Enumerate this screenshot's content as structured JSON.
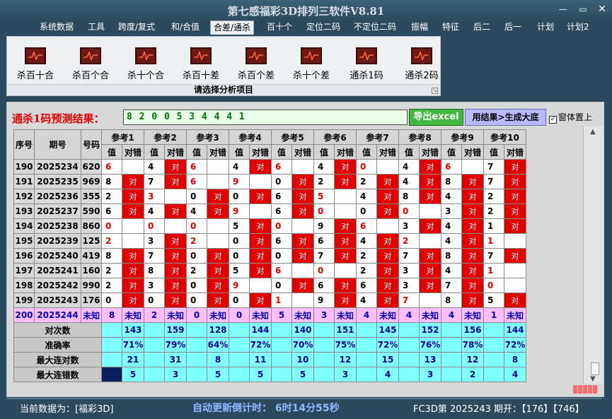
{
  "window": {
    "title": "第七感福彩3D排列三软件V8.81"
  },
  "menu": [
    "系统数据",
    "工具",
    "跨度/复式",
    "和/合值",
    "合差/通杀",
    "百十个",
    "定位二码",
    "不定位二码",
    "振幅",
    "特征",
    "后二",
    "后一",
    "计划",
    "计划2"
  ],
  "menu_active_index": 4,
  "ribbon": {
    "buttons": [
      "杀百十合",
      "杀百个合",
      "杀十个合",
      "杀百十差",
      "杀百个差",
      "杀十个差",
      "通杀1码",
      "通杀2码"
    ],
    "caption": "请选择分析项目"
  },
  "prediction": {
    "label": "通杀1码预测结果：",
    "value": "8 2 0 0 5 3 4 4 4 1",
    "export_label": "导出excel",
    "generate_label": "用结果>生成大底",
    "ontop_label": "窗体置上",
    "ontop_checked": true,
    "ontop_mark": "✓"
  },
  "table": {
    "headers": {
      "seq": "序号",
      "period": "期号",
      "number": "号码",
      "value": "值",
      "hit": "对错"
    },
    "refs": [
      "参考1",
      "参考2",
      "参考3",
      "参考4",
      "参考5",
      "参考6",
      "参考7",
      "参考8",
      "参考9",
      "参考10"
    ],
    "hit_text": "对",
    "rows": [
      {
        "seq": "190",
        "period": "2025234",
        "num": "620",
        "vals": [
          "6",
          "4",
          "6",
          "4",
          "6",
          "4",
          "0",
          "4",
          "6",
          "7"
        ],
        "hits": [
          0,
          1,
          0,
          1,
          0,
          1,
          0,
          1,
          0,
          1
        ]
      },
      {
        "seq": "191",
        "period": "2025235",
        "num": "969",
        "vals": [
          "8",
          "7",
          "6",
          "9",
          "0",
          "2",
          "2",
          "4",
          "8",
          "7"
        ],
        "hits": [
          1,
          1,
          0,
          0,
          1,
          1,
          1,
          1,
          1,
          1
        ]
      },
      {
        "seq": "192",
        "period": "2025236",
        "num": "355",
        "vals": [
          "2",
          "3",
          "0",
          "0",
          "6",
          "5",
          "4",
          "8",
          "4",
          "2"
        ],
        "hits": [
          1,
          0,
          1,
          1,
          1,
          0,
          1,
          1,
          1,
          1
        ]
      },
      {
        "seq": "193",
        "period": "2025237",
        "num": "590",
        "vals": [
          "6",
          "4",
          "4",
          "9",
          "6",
          "0",
          "0",
          "0",
          "3",
          "2"
        ],
        "hits": [
          1,
          1,
          1,
          0,
          1,
          0,
          1,
          0,
          1,
          1
        ]
      },
      {
        "seq": "194",
        "period": "2025238",
        "num": "860",
        "vals": [
          "0",
          "0",
          "0",
          "5",
          "0",
          "9",
          "6",
          "3",
          "4",
          "1"
        ],
        "hits": [
          0,
          0,
          0,
          1,
          0,
          1,
          0,
          1,
          1,
          1
        ]
      },
      {
        "seq": "195",
        "period": "2025239",
        "num": "125",
        "vals": [
          "2",
          "3",
          "2",
          "0",
          "6",
          "6",
          "4",
          "2",
          "4",
          "1"
        ],
        "hits": [
          0,
          1,
          0,
          1,
          1,
          1,
          1,
          0,
          1,
          0
        ]
      },
      {
        "seq": "196",
        "period": "2025240",
        "num": "419",
        "vals": [
          "8",
          "7",
          "0",
          "0",
          "0",
          "7",
          "2",
          "7",
          "8",
          "7"
        ],
        "hits": [
          1,
          1,
          1,
          1,
          1,
          1,
          1,
          1,
          1,
          1
        ]
      },
      {
        "seq": "197",
        "period": "2025241",
        "num": "160",
        "vals": [
          "2",
          "8",
          "2",
          "5",
          "6",
          "0",
          "2",
          "3",
          "4",
          "1"
        ],
        "hits": [
          1,
          1,
          1,
          1,
          0,
          0,
          1,
          1,
          1,
          0
        ]
      },
      {
        "seq": "198",
        "period": "2025242",
        "num": "990",
        "vals": [
          "2",
          "3",
          "0",
          "9",
          "0",
          "6",
          "6",
          "3",
          "7",
          "0"
        ],
        "hits": [
          1,
          1,
          1,
          0,
          1,
          1,
          1,
          1,
          1,
          0
        ]
      },
      {
        "seq": "199",
        "period": "2025243",
        "num": "176",
        "vals": [
          "0",
          "0",
          "0",
          "0",
          "1",
          "9",
          "4",
          "7",
          "8",
          "5"
        ],
        "hits": [
          1,
          1,
          1,
          1,
          0,
          1,
          1,
          0,
          1,
          1
        ]
      }
    ],
    "unknown_row": {
      "seq": "200",
      "period": "2025244",
      "num": "未知",
      "vals": [
        "8",
        "2",
        "0",
        "0",
        "5",
        "3",
        "4",
        "4",
        "4",
        "1"
      ],
      "hit_text": "未知"
    },
    "stats": [
      {
        "label": "对次数",
        "values": [
          "143",
          "159",
          "128",
          "144",
          "140",
          "151",
          "145",
          "152",
          "156",
          "144"
        ]
      },
      {
        "label": "准确率",
        "values": [
          "71%",
          "79%",
          "64%",
          "72%",
          "70%",
          "75%",
          "72%",
          "76%",
          "78%",
          "72%"
        ]
      },
      {
        "label": "最大连对数",
        "values": [
          "21",
          "31",
          "8",
          "11",
          "10",
          "12",
          "15",
          "13",
          "12",
          "8"
        ]
      },
      {
        "label": "最大连错数",
        "values": [
          "5",
          "3",
          "5",
          "5",
          "5",
          "3",
          "4",
          "3",
          "2",
          "4"
        ]
      }
    ]
  },
  "status": {
    "current_data": "当前数据为：[福彩3D]",
    "countdown": "自动更新倒计时： 6时14分55秒",
    "draw_info": "FC3D第 2025243 期开：【176】【746】"
  }
}
